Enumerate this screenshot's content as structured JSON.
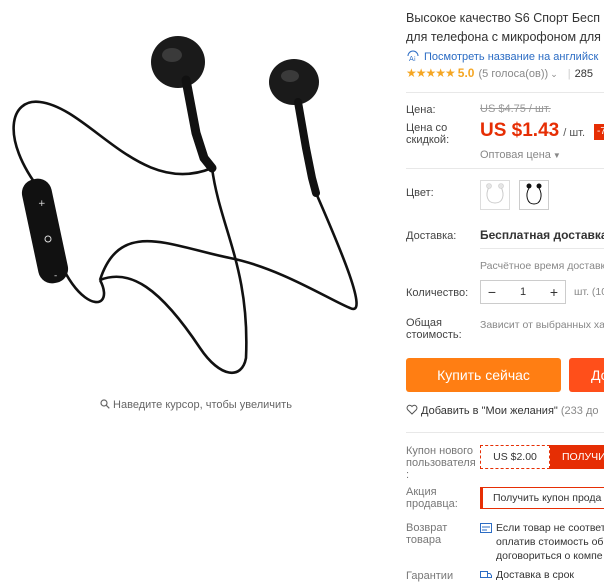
{
  "image_area": {
    "zoom_hint": "Наведите курсор, чтобы увеличить"
  },
  "product": {
    "title_line1": "Высокое качество S6 Спорт Бесп",
    "title_line2": "для телефона с микрофоном для",
    "translate_link": "Посмотреть название на английск",
    "stars": "★★★★★",
    "rating": "5.0",
    "votes": "(5 голоса(ов))",
    "orders": "285"
  },
  "price": {
    "label_price": "Цена:",
    "old_price": "US $4.75 / шт.",
    "label_discount_line1": "Цена со",
    "label_discount_line2": "скидкой:",
    "new_price": "US $1.43",
    "unit": "/ шт.",
    "discount_badge": "-7",
    "wholesale": "Оптовая цена"
  },
  "color": {
    "label": "Цвет:",
    "options": [
      "white-earphones",
      "black-earphones"
    ]
  },
  "shipping": {
    "label": "Доставка:",
    "value": "Бесплатная доставка в",
    "estimate": "Расчётное время доставк"
  },
  "quantity": {
    "label": "Количество:",
    "value": "1",
    "minus": "−",
    "plus": "+",
    "unit": "шт. (10"
  },
  "total": {
    "label_line1": "Общая",
    "label_line2": "стоимость:",
    "value": "Зависит от выбранных ха"
  },
  "actions": {
    "buy_now": "Купить сейчас",
    "add_to_cart": "До",
    "wishlist": "Добавить в \"Мои желания\"",
    "wishlist_count": "(233 до"
  },
  "coupons": {
    "new_user_line1": "Купон нового",
    "new_user_line2": "пользователя",
    "new_user_line3": ":",
    "new_user_amount": "US $2.00",
    "new_user_get": "ПОЛУЧИ",
    "seller_line1": "Акция",
    "seller_line2": "продавца:",
    "seller_get": "Получить купон прода"
  },
  "returns": {
    "label_line1": "Возврат",
    "label_line2": "товара",
    "text_line1": "Если товар не соответ",
    "text_line2": "оплатив стоимость об",
    "text_line3": "договориться о компе"
  },
  "guarantee": {
    "label": "Гарантии",
    "text": "Доставка в срок"
  },
  "colors": {
    "accent_orange": "#ff7e13",
    "accent_red": "#e62e04",
    "star": "#f5a623",
    "link": "#2b6cc4"
  }
}
